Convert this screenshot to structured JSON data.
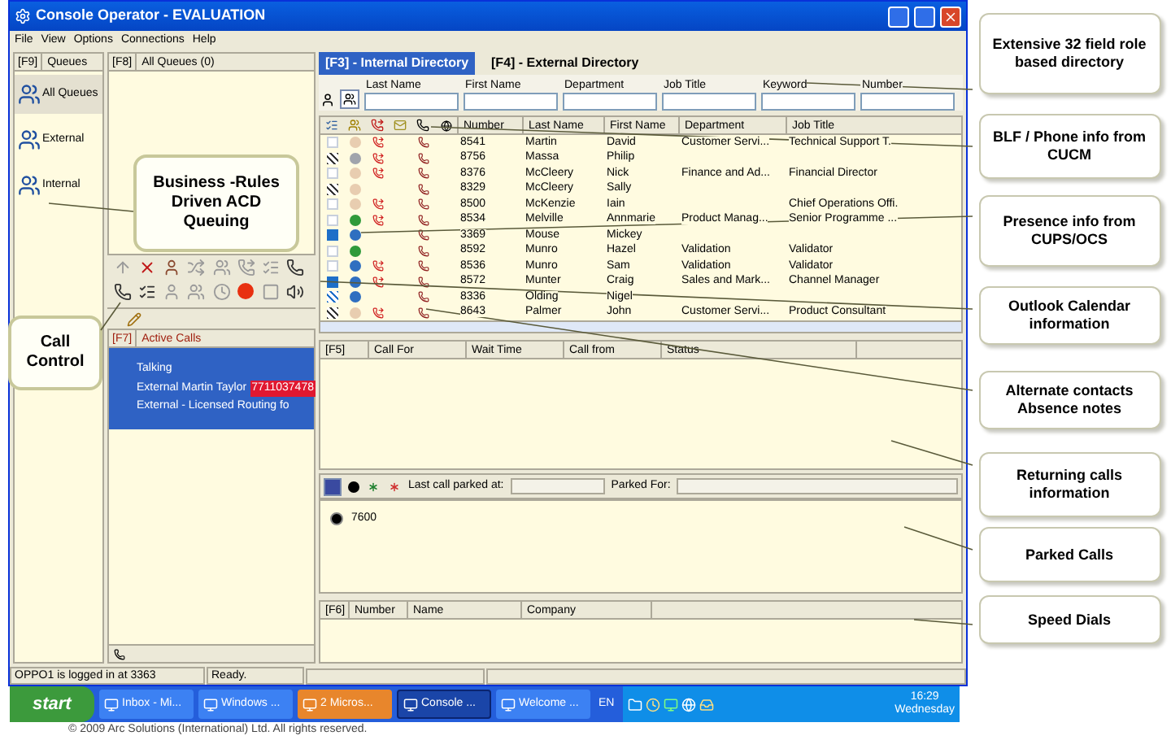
{
  "window": {
    "title": "Console Operator - EVALUATION"
  },
  "menu": [
    "File",
    "View",
    "Options",
    "Connections",
    "Help"
  ],
  "queues_panel": {
    "key": "[F9]",
    "title": "Queues",
    "items": [
      {
        "label": "All Queues",
        "selected": true
      },
      {
        "label": "External",
        "selected": false
      },
      {
        "label": "Internal",
        "selected": false
      }
    ]
  },
  "queue_list": {
    "key": "[F8]",
    "title": "All Queues (0)"
  },
  "active_calls": {
    "key": "[F7]",
    "title": "Active Calls",
    "calls": [
      {
        "selected": true,
        "state": "Talking",
        "caller": "External Martin Taylor",
        "number": "7711037478",
        "route": "External - Licensed Routing fo"
      }
    ]
  },
  "directory": {
    "tabs": [
      {
        "label": "[F3] - Internal Directory",
        "selected": true
      },
      {
        "label": "[F4] - External Directory",
        "selected": false
      }
    ],
    "search_fields": [
      "Last Name",
      "First Name",
      "Department",
      "Job Title",
      "Keyword",
      "Number"
    ],
    "columns": [
      "Number",
      "Last Name",
      "First Name",
      "Department",
      "Job Title"
    ],
    "rows": [
      {
        "calendar": {
          "kind": "free"
        },
        "color": "#e8cdb0",
        "forwarded": true,
        "cells": [
          "8541",
          "Martin",
          "David",
          "Customer Servi...",
          "Technical Support T."
        ]
      },
      {
        "calendar": {
          "kind": "busy"
        },
        "color": "#a0a4ac",
        "forwarded": true,
        "cells": [
          "8756",
          "Massa",
          "Philip",
          "",
          ""
        ]
      },
      {
        "calendar": {
          "kind": "free"
        },
        "color": "#e8cdb0",
        "forwarded": true,
        "cells": [
          "8376",
          "McCleery",
          "Nick",
          "Finance and Ad...",
          "Financial Director"
        ]
      },
      {
        "calendar": {
          "kind": "busy"
        },
        "color": "#e8cdb0",
        "forwarded": false,
        "cells": [
          "8329",
          "McCleery",
          "Sally",
          "",
          ""
        ]
      },
      {
        "calendar": {
          "kind": "free"
        },
        "color": "#e8cdb0",
        "forwarded": true,
        "cells": [
          "8500",
          "McKenzie",
          "Iain",
          "",
          "Chief Operations Offi."
        ]
      },
      {
        "calendar": {
          "kind": "free"
        },
        "color": "#2f9a3a",
        "forwarded": true,
        "cells": [
          "8534",
          "Melville",
          "Annmarie",
          "Product Manag...",
          "Senior Programme ..."
        ]
      },
      {
        "calendar": {
          "kind": "away"
        },
        "color": "#2f6fc0",
        "forwarded": false,
        "cells": [
          "3369",
          "Mouse",
          "Mickey",
          "",
          ""
        ]
      },
      {
        "calendar": {
          "kind": "free"
        },
        "color": "#2f9a3a",
        "forwarded": false,
        "cells": [
          "8592",
          "Munro",
          "Hazel",
          "Validation",
          "Validator"
        ]
      },
      {
        "calendar": {
          "kind": "free"
        },
        "color": "#2f6fc0",
        "forwarded": true,
        "cells": [
          "8536",
          "Munro",
          "Sam",
          "Validation",
          "Validator"
        ]
      },
      {
        "calendar": {
          "kind": "away"
        },
        "color": "#2f6fc0",
        "forwarded": true,
        "cells": [
          "8572",
          "Munter",
          "Craig",
          "Sales and Mark...",
          "Channel Manager"
        ]
      },
      {
        "calendar": {
          "kind": "tentative"
        },
        "color": "#2f6fc0",
        "forwarded": false,
        "cells": [
          "8336",
          "Olding",
          "Nigel",
          "",
          ""
        ]
      },
      {
        "calendar": {
          "kind": "busy"
        },
        "color": "#e8cdb0",
        "forwarded": true,
        "cells": [
          "8643",
          "Palmer",
          "John",
          "Customer Servi...",
          "Product Consultant"
        ]
      }
    ]
  },
  "waiting_calls": {
    "key": "[F5]",
    "columns": [
      "Call For",
      "Wait Time",
      "Call from",
      "Status"
    ]
  },
  "parking": {
    "last_parked_label": "Last call parked at:",
    "parked_for_label": "Parked For:",
    "slots": [
      "7600"
    ]
  },
  "speed_dials": {
    "key": "[F6]",
    "columns": [
      "Number",
      "Name",
      "Company"
    ]
  },
  "status_bar": [
    "OPPO1 is logged in at 3363",
    "Ready."
  ],
  "taskbar": {
    "start": "start",
    "tasks": [
      {
        "label": "Inbox - Mi...",
        "selected": false,
        "flashing": false
      },
      {
        "label": "Windows ...",
        "selected": false,
        "flashing": false
      },
      {
        "label": "2 Micros...",
        "selected": false,
        "flashing": true
      },
      {
        "label": "Console ...",
        "selected": true,
        "flashing": false
      },
      {
        "label": "Welcome ...",
        "selected": false,
        "flashing": false
      }
    ],
    "language": "EN",
    "clock": "16:29",
    "day": "Wednesday"
  },
  "overlay_callouts": [
    "Business -Rules Driven ACD Queuing",
    "Call Control"
  ],
  "callouts": [
    "Extensive 32 field role based directory",
    "BLF / Phone info from CUCM",
    "Presence info from CUPS/OCS",
    "Outlook Calendar information",
    "Alternate contacts Absence notes",
    "Returning calls information",
    "Parked Calls",
    "Speed Dials"
  ],
  "copyright": "© 2009 Arc Solutions (International) Ltd. All rights reserved."
}
